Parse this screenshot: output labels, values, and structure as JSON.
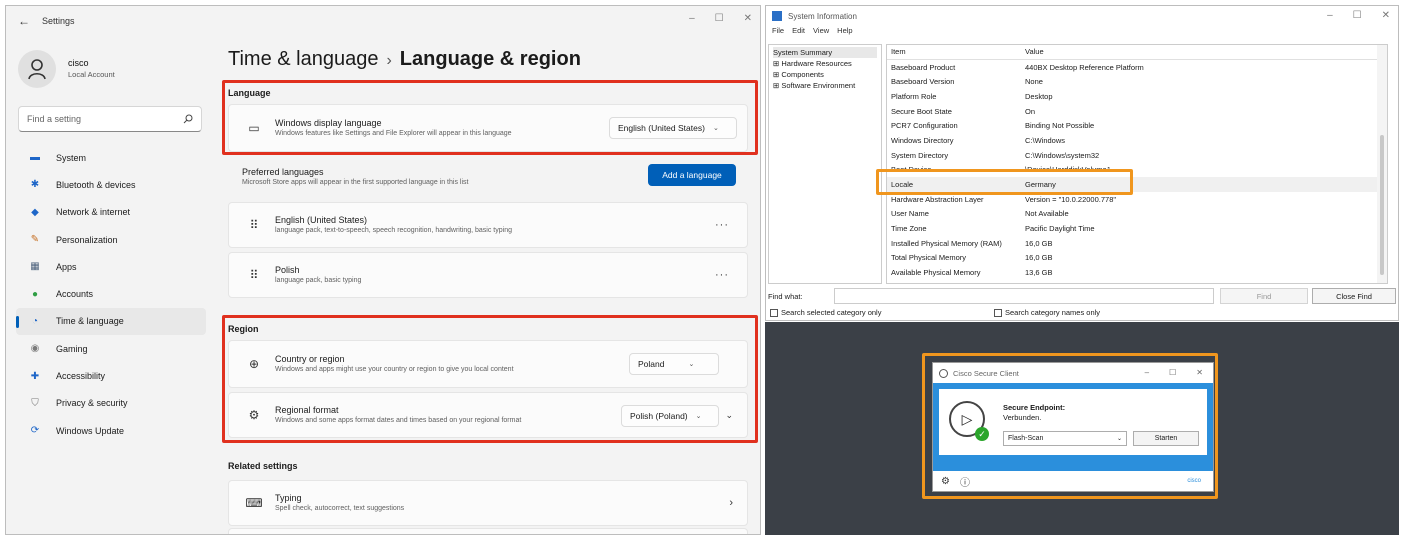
{
  "settings": {
    "window_title": "Settings",
    "back_icon": "←",
    "controls": [
      "–",
      "☐",
      "✕"
    ],
    "profile": {
      "name": "cisco",
      "type": "Local Account"
    },
    "search_placeholder": "Find a setting",
    "nav": [
      {
        "label": "System",
        "icon": "▬",
        "color": "#1e66c8"
      },
      {
        "label": "Bluetooth & devices",
        "icon": "✱",
        "color": "#1e66c8"
      },
      {
        "label": "Network & internet",
        "icon": "◆",
        "color": "#1e66c8"
      },
      {
        "label": "Personalization",
        "icon": "✎",
        "color": "#c46b1c"
      },
      {
        "label": "Apps",
        "icon": "▦",
        "color": "#4a5f7a"
      },
      {
        "label": "Accounts",
        "icon": "●",
        "color": "#2f9e44"
      },
      {
        "label": "Time & language",
        "icon": "◔",
        "color": "#1e66c8"
      },
      {
        "label": "Gaming",
        "icon": "◉",
        "color": "#7a7a7a"
      },
      {
        "label": "Accessibility",
        "icon": "✚",
        "color": "#1e66c8"
      },
      {
        "label": "Privacy & security",
        "icon": "⛉",
        "color": "#7a7a7a"
      },
      {
        "label": "Windows Update",
        "icon": "⟳",
        "color": "#1e66c8"
      }
    ],
    "active_nav": "Time & language",
    "breadcrumb": {
      "parent": "Time & language",
      "sep": "›",
      "current": "Language & region"
    },
    "language_label": "Language",
    "display_language": {
      "title": "Windows display language",
      "subtitle": "Windows features like Settings and File Explorer will appear in this language",
      "value": "English (United States)"
    },
    "preferred": {
      "title": "Preferred languages",
      "subtitle": "Microsoft Store apps will appear in the first supported language in this list",
      "button": "Add a language"
    },
    "lang_items": [
      {
        "title": "English (United States)",
        "subtitle": "language pack, text-to-speech, speech recognition, handwriting, basic typing"
      },
      {
        "title": "Polish",
        "subtitle": "language pack, basic typing"
      }
    ],
    "region_label": "Region",
    "country": {
      "title": "Country or region",
      "subtitle": "Windows and apps might use your country or region to give you local content",
      "value": "Poland"
    },
    "regional_format": {
      "title": "Regional format",
      "subtitle": "Windows and some apps format dates and times based on your regional format",
      "value": "Polish (Poland)"
    },
    "related_label": "Related settings",
    "typing": {
      "title": "Typing",
      "subtitle": "Spell check, autocorrect, text suggestions"
    }
  },
  "sysinfo": {
    "title": "System Information",
    "menu": [
      "File",
      "Edit",
      "View",
      "Help"
    ],
    "tree": [
      "System Summary",
      "⊞ Hardware Resources",
      "⊞ Components",
      "⊞ Software Environment"
    ],
    "columns": {
      "item": "Item",
      "value": "Value"
    },
    "rows": [
      {
        "item": "Baseboard Product",
        "value": "440BX Desktop Reference Platform"
      },
      {
        "item": "Baseboard Version",
        "value": "None"
      },
      {
        "item": "Platform Role",
        "value": "Desktop"
      },
      {
        "item": "Secure Boot State",
        "value": "On"
      },
      {
        "item": "PCR7 Configuration",
        "value": "Binding Not Possible"
      },
      {
        "item": "Windows Directory",
        "value": "C:\\Windows"
      },
      {
        "item": "System Directory",
        "value": "C:\\Windows\\system32"
      },
      {
        "item": "Boot Device",
        "value": "\\Device\\HarddiskVolume1"
      },
      {
        "item": "Locale",
        "value": "Germany"
      },
      {
        "item": "Hardware Abstraction Layer",
        "value": "Version = \"10.0.22000.778\""
      },
      {
        "item": "User Name",
        "value": "Not Available"
      },
      {
        "item": "Time Zone",
        "value": "Pacific Daylight Time"
      },
      {
        "item": "Installed Physical Memory (RAM)",
        "value": "16,0 GB"
      },
      {
        "item": "Total Physical Memory",
        "value": "16,0 GB"
      },
      {
        "item": "Available Physical Memory",
        "value": "13,6 GB"
      }
    ],
    "find_label": "Find what:",
    "find_button": "Find",
    "close_find_button": "Close Find",
    "check1": "Search selected category only",
    "check2": "Search category names only"
  },
  "cisco": {
    "title": "Cisco Secure Client",
    "heading": "Secure Endpoint:",
    "status": "Verbunden.",
    "select_value": "Flash-Scan",
    "button": "Starten",
    "brand": "cisco"
  },
  "colors": {
    "highlight_red": "#e0301e",
    "highlight_orange": "#f0961e",
    "accent": "#005fb8"
  }
}
